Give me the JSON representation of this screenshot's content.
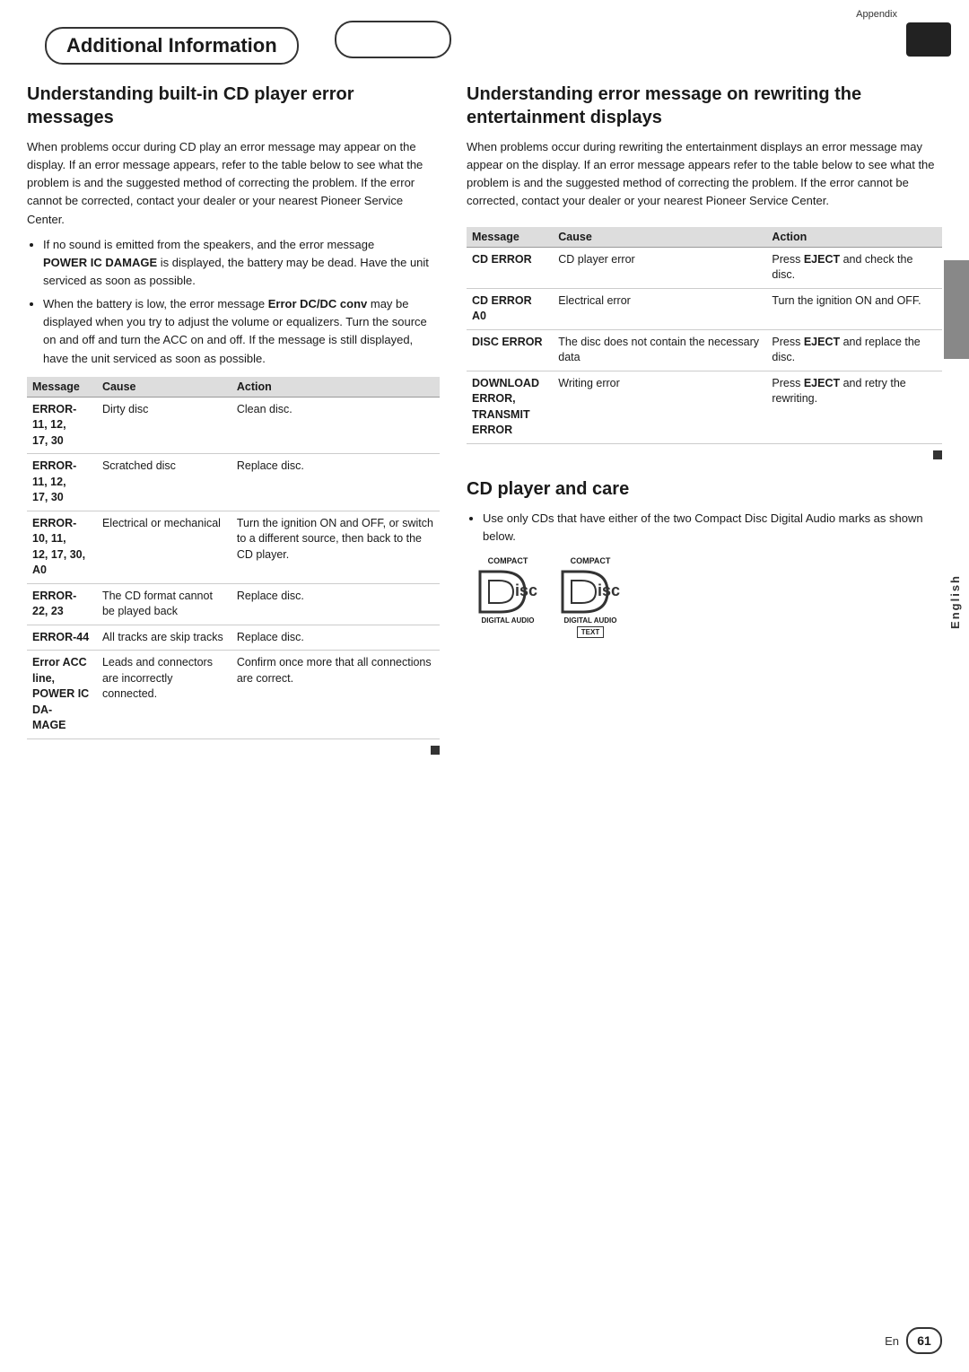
{
  "page": {
    "appendix_label": "Appendix",
    "additional_information_label": "Additional Information",
    "header_right_label": "",
    "english_label": "English",
    "page_number": "61",
    "en_label": "En"
  },
  "left_section": {
    "title": "Understanding built-in CD player error messages",
    "intro": "When problems occur during CD play an error message may appear on the display. If an error message appears, refer to the table below to see what the problem is and the suggested method of correcting the problem. If the error cannot be corrected, contact your dealer or your nearest Pioneer Service Center.",
    "bullet1_main": "If no sound is emitted from the speakers, and the error message",
    "bullet1_bold": "POWER IC DAMAGE",
    "bullet1_rest": " is displayed, the battery may be dead. Have the unit serviced as soon as possible.",
    "bullet2_main": "When the battery is low, the error message ",
    "bullet2_bold": "Error DC/DC conv",
    "bullet2_rest": " may be displayed when you try to adjust the volume or equalizers. Turn the source on and off and turn the ACC on and off. If the message is still displayed, have the unit serviced as soon as possible.",
    "table": {
      "headers": [
        "Message",
        "Cause",
        "Action"
      ],
      "rows": [
        {
          "message": "ERROR-11, 12, 17, 30",
          "cause": "Dirty disc",
          "action": "Clean disc."
        },
        {
          "message": "ERROR-11, 12, 17, 30",
          "cause": "Scratched disc",
          "action": "Replace disc."
        },
        {
          "message": "ERROR-10, 11, 12, 17, 30, A0",
          "cause": "Electrical or mechanical",
          "action": "Turn the ignition ON and OFF, or switch to a different source, then back to the CD player."
        },
        {
          "message": "ERROR-22, 23",
          "cause": "The CD format cannot be played back",
          "action": "Replace disc."
        },
        {
          "message": "ERROR-44",
          "cause": "All tracks are skip tracks",
          "action": "Replace disc."
        },
        {
          "message": "Error ACC line, POWER IC DAMAGE",
          "cause": "Leads and connectors are incorrectly connected.",
          "action": "Confirm once more that all connections are correct."
        }
      ]
    }
  },
  "right_section": {
    "title": "Understanding error message on rewriting the entertainment displays",
    "intro": "When problems occur during rewriting the entertainment displays an error message may appear on the display. If an error message appears refer to the table below to see what the problem is and the suggested method of correcting the problem. If the error cannot be corrected, contact your dealer or your nearest Pioneer Service Center.",
    "table": {
      "headers": [
        "Message",
        "Cause",
        "Action"
      ],
      "rows": [
        {
          "message": "CD ERROR",
          "cause": "CD player error",
          "action": "Press EJECT and check the disc."
        },
        {
          "message": "CD ERROR A0",
          "cause": "Electrical error",
          "action": "Turn the ignition ON and OFF."
        },
        {
          "message": "DISC ERROR",
          "cause": "The disc does not contain the necessary data",
          "action": "Press EJECT and replace the disc."
        },
        {
          "message": "DOWNLOAD ERROR, TRANSMIT ERROR",
          "cause": "Writing error",
          "action": "Press EJECT and retry the rewriting."
        }
      ]
    },
    "cd_care": {
      "title": "CD player and care",
      "bullet1": "Use only CDs that have either of the two Compact Disc Digital Audio marks as shown below.",
      "logo1_top": "COMPACT",
      "logo1_main": "DISC",
      "logo1_bottom": "DIGITAL AUDIO",
      "logo2_top": "COMPACT",
      "logo2_main": "DISC",
      "logo2_sub": "DIGITAL AUDIO",
      "logo2_bottom": "TEXT"
    }
  }
}
